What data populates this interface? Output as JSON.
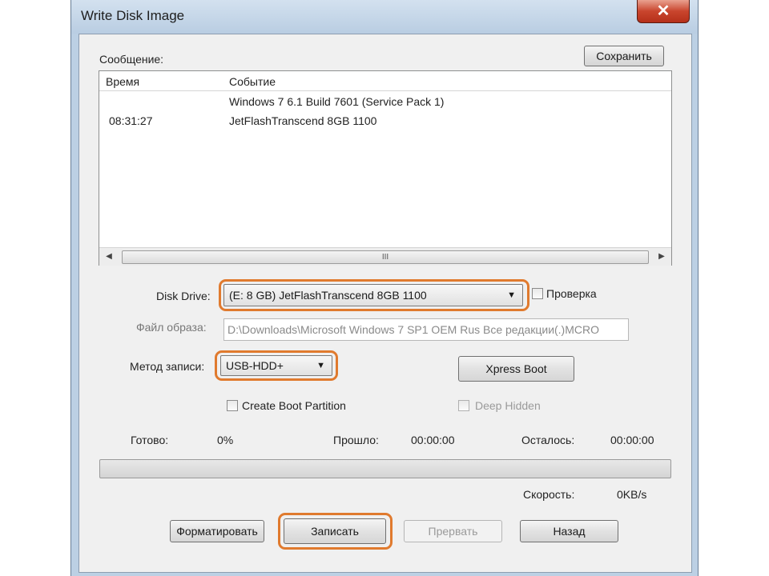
{
  "window": {
    "title": "Write Disk Image",
    "close_symbol": "✕"
  },
  "message": {
    "label": "Сообщение:",
    "save_button": "Сохранить"
  },
  "log": {
    "columns": [
      "Время",
      "Событие"
    ],
    "rows": [
      {
        "time": "",
        "event": "Windows 7 6.1 Build 7601 (Service Pack 1)"
      },
      {
        "time": "08:31:27",
        "event": "JetFlashTranscend 8GB  1100"
      }
    ],
    "scroll_grip": "III"
  },
  "disk_drive": {
    "label": "Disk Drive:",
    "value": "(E: 8 GB) JetFlashTranscend 8GB  1100"
  },
  "verify": {
    "label": "Проверка",
    "checked": false
  },
  "image_file": {
    "label": "Файл образа:",
    "value": "D:\\Downloads\\Microsoft Windows 7 SP1 OEM Rus Все редакции(.)МСRO"
  },
  "write_method": {
    "label": "Метод записи:",
    "value": "USB-HDD+"
  },
  "xpress_boot": "Xpress Boot",
  "create_boot_partition": {
    "label": "Create Boot Partition",
    "checked": false
  },
  "deep_hidden": {
    "label": "Deep Hidden",
    "checked": false
  },
  "stats": {
    "done_label": "Готово:",
    "done_value": "0%",
    "elapsed_label": "Прошло:",
    "elapsed_value": "00:00:00",
    "remaining_label": "Осталось:",
    "remaining_value": "00:00:00",
    "speed_label": "Скорость:",
    "speed_value": "0KB/s"
  },
  "progress": {
    "fraction": 0
  },
  "buttons": {
    "format": "Форматировать",
    "write": "Записать",
    "abort": "Прервать",
    "back": "Назад"
  },
  "colors": {
    "highlight": "#e07a2e",
    "title_bar": "#c7d8ea",
    "close_button": "#c9452d"
  }
}
